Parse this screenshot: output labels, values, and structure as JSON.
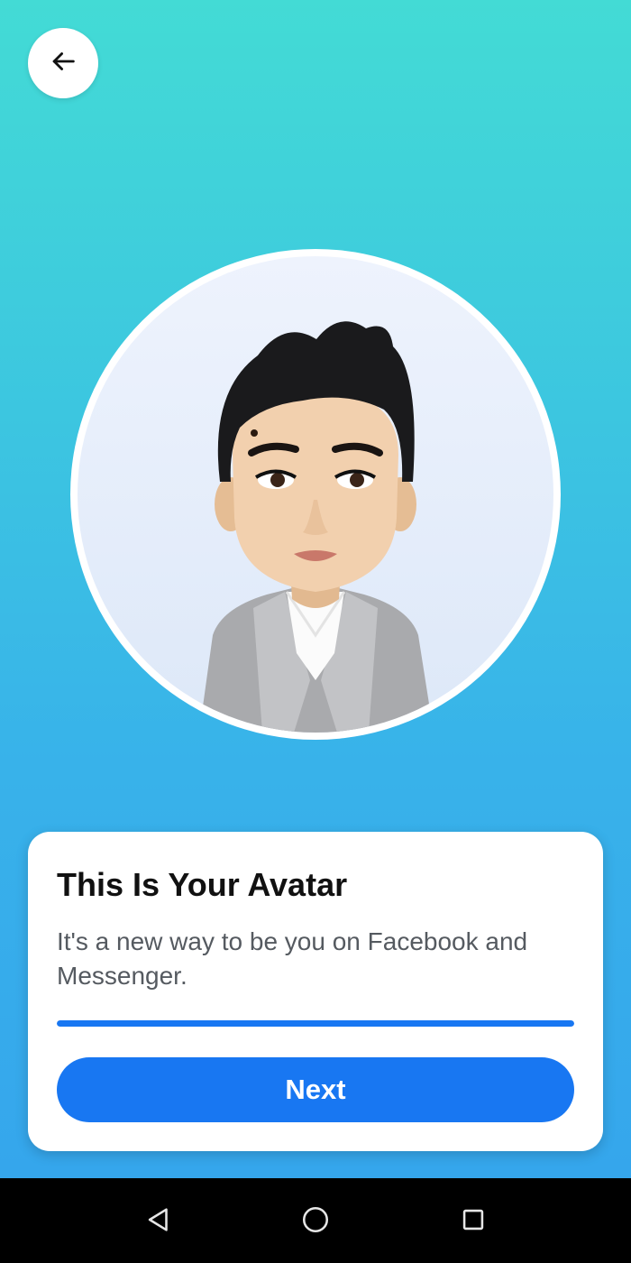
{
  "header": {
    "back_icon": "arrow-left-icon"
  },
  "avatar": {
    "description_icon": "avatar-portrait"
  },
  "card": {
    "title": "This Is Your Avatar",
    "subtitle": "It's a new way to be you on Facebook and Messenger.",
    "progress": 1.0,
    "next_label": "Next"
  },
  "navbar": {
    "back_icon": "triangle-back-icon",
    "home_icon": "circle-home-icon",
    "recents_icon": "square-recents-icon"
  },
  "colors": {
    "accent": "#1877f2",
    "background_top": "#43dbd5",
    "background_bottom": "#35a6ec",
    "card": "#ffffff",
    "navbar": "#000000"
  }
}
